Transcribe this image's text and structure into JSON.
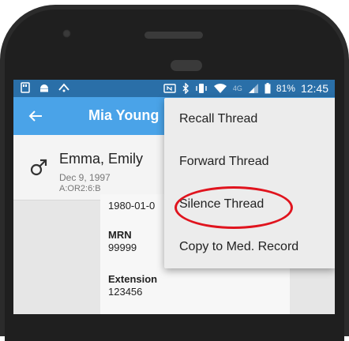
{
  "status_bar": {
    "battery_percent": "81%",
    "time": "12:45",
    "network_label": "4G",
    "icons": [
      "sd-card-icon",
      "android-icon",
      "sync-icon",
      "nfc-icon",
      "bluetooth-icon",
      "vibrate-icon",
      "wifi-icon",
      "signal-icon",
      "battery-icon"
    ]
  },
  "app_bar": {
    "back_icon": "back-arrow-icon",
    "title": "Mia Young"
  },
  "patient": {
    "gender_icon": "male-icon",
    "name": "Emma, Emily",
    "dob": "Dec 9, 1997",
    "location": "A:OR2:6:B"
  },
  "details": {
    "dob_value": "1980-01-0",
    "mrn_label": "MRN",
    "mrn_value": "99999",
    "extension_label": "Extension",
    "extension_value": "123456"
  },
  "menu": {
    "items": [
      {
        "label": "Recall Thread"
      },
      {
        "label": "Forward Thread"
      },
      {
        "label": "Silence Thread"
      },
      {
        "label": "Copy to Med. Record"
      }
    ],
    "highlighted_index": 2,
    "highlight_color": "#e0141e"
  },
  "colors": {
    "status_bar": "#2a6fa8",
    "app_bar": "#4aa3e8"
  }
}
